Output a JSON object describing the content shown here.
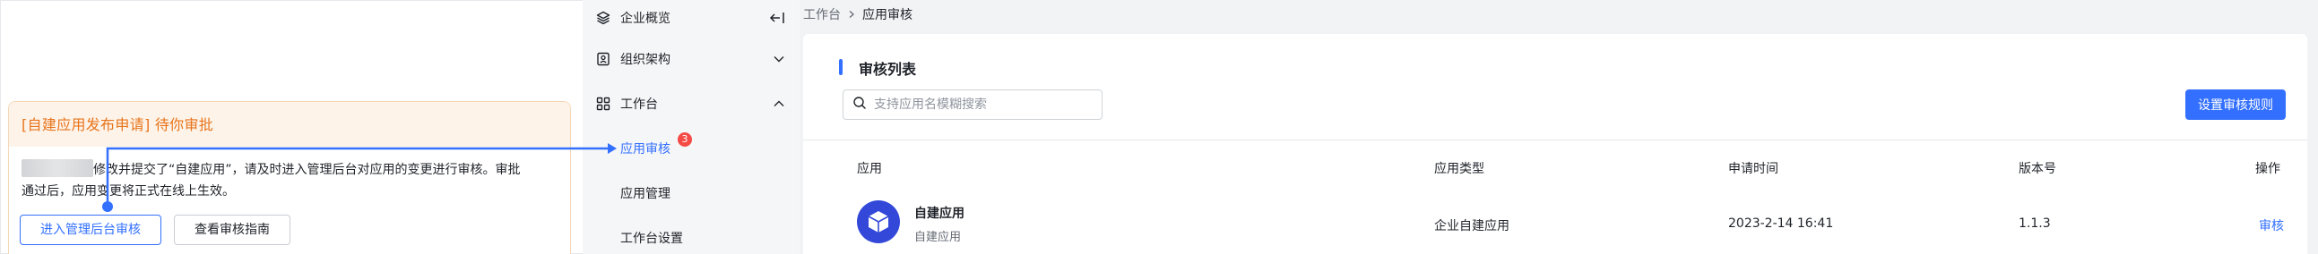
{
  "notice": {
    "title": "[自建应用发布申请] 待你审批",
    "body_line1": "修改并提交了“自建应用”，请及时进入管理后台对应用的变更进行审核。审批",
    "body_line2": "通过后，应用变更将正式在线上生效。",
    "primary_button": "进入管理后台审核",
    "secondary_button": "查看审核指南"
  },
  "sidebar": {
    "items": [
      {
        "label": "企业概览",
        "icon": "layers-icon"
      },
      {
        "label": "组织架构",
        "icon": "org-icon",
        "chevron": "chevron-down-icon"
      },
      {
        "label": "工作台",
        "icon": "grid-icon",
        "chevron": "chevron-up-icon"
      },
      {
        "label": "应用审核",
        "badge": "3",
        "active": true
      },
      {
        "label": "应用管理"
      },
      {
        "label": "工作台设置"
      }
    ],
    "collapse_icon": "collapse-left-icon"
  },
  "breadcrumb": {
    "root": "工作台",
    "current": "应用审核"
  },
  "main": {
    "section_title": "审核列表",
    "search_placeholder": "支持应用名模糊搜索",
    "rule_button": "设置审核规则",
    "table": {
      "headers": [
        "应用",
        "应用类型",
        "申请时间",
        "版本号",
        "操作"
      ],
      "rows": [
        {
          "app_name": "自建应用",
          "app_sub": "自建应用",
          "type": "企业自建应用",
          "time": "2023-2-14 16:41",
          "version": "1.1.3",
          "action": "审核"
        }
      ]
    }
  },
  "colors": {
    "accent": "#3370ff",
    "notice_title": "#e8741c",
    "badge": "#f54a45",
    "avatar": "#3348d9"
  }
}
